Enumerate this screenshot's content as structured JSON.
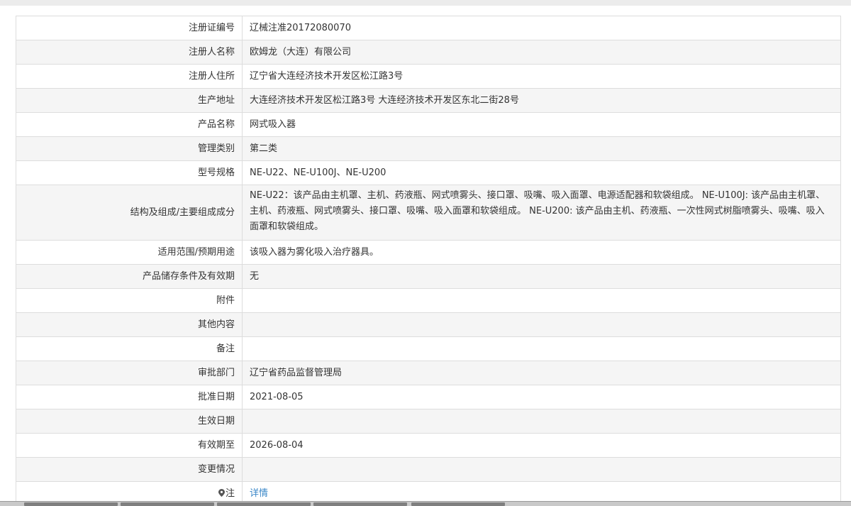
{
  "rows": [
    {
      "label": "注册证编号",
      "value": "辽械注准20172080070"
    },
    {
      "label": "注册人名称",
      "value": "欧姆龙（大连）有限公司"
    },
    {
      "label": "注册人住所",
      "value": "辽宁省大连经济技术开发区松江路3号"
    },
    {
      "label": "生产地址",
      "value": "大连经济技术开发区松江路3号 大连经济技术开发区东北二街28号"
    },
    {
      "label": "产品名称",
      "value": "网式吸入器"
    },
    {
      "label": "管理类别",
      "value": "第二类"
    },
    {
      "label": "型号规格",
      "value": "NE-U22、NE-U100J、NE-U200"
    },
    {
      "label": "结构及组成/主要组成成分",
      "value": "NE-U22：该产品由主机罩、主机、药液瓶、网式喷雾头、接口罩、吸嘴、吸入面罩、电源适配器和软袋组成。 NE-U100J: 该产品由主机罩、主机、药液瓶、网式喷雾头、接口罩、吸嘴、吸入面罩和软袋组成。 NE-U200: 该产品由主机、药液瓶、一次性网式树脂喷雾头、吸嘴、吸入面罩和软袋组成。"
    },
    {
      "label": "适用范围/预期用途",
      "value": "该吸入器为雾化吸入治疗器具。"
    },
    {
      "label": "产品储存条件及有效期",
      "value": "无"
    },
    {
      "label": "附件",
      "value": ""
    },
    {
      "label": "其他内容",
      "value": ""
    },
    {
      "label": "备注",
      "value": ""
    },
    {
      "label": "审批部门",
      "value": "辽宁省药品监督管理局"
    },
    {
      "label": "批准日期",
      "value": "2021-08-05"
    },
    {
      "label": "生效日期",
      "value": ""
    },
    {
      "label": "有效期至",
      "value": "2026-08-04"
    },
    {
      "label": "变更情况",
      "value": ""
    },
    {
      "label": "注",
      "value": "详情"
    }
  ]
}
